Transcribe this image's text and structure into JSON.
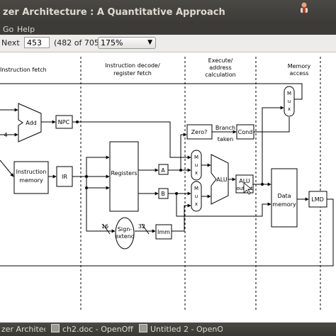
{
  "window": {
    "title": "zer Architecture : A Quantitative Approach"
  },
  "menu": {
    "go": "Go",
    "help": "Help"
  },
  "toolbar": {
    "next_label": "Next",
    "page_value": "453",
    "page_count": "(482 of 705)",
    "zoom_value": "175%"
  },
  "diagram": {
    "stages": {
      "fetch": "Instruction fetch",
      "decode_1": "Instruction decode/",
      "decode_2": "register fetch",
      "exec_1": "Execute/",
      "exec_2": "address",
      "exec_3": "calculation",
      "mem_1": "Memory",
      "mem_2": "access"
    },
    "blocks": {
      "add": "Add",
      "four": "4",
      "npc": "NPC",
      "imem_1": "Instruction",
      "imem_2": "memory",
      "ir": "IR",
      "registers": "Registers",
      "a": "A",
      "b": "B",
      "zero": "Zero?",
      "branch_1": "Branch",
      "branch_2": "taken",
      "cond": "Cond",
      "mux": "M u x",
      "alu": "ALU",
      "alu_out_1": "ALU",
      "alu_out_2": "output",
      "dmem_1": "Data",
      "dmem_2": "memory",
      "lmd": "LMD",
      "sign_1": "Sign-",
      "sign_2": "extend",
      "imm": "Imm",
      "w16": "16",
      "w32": "32"
    }
  },
  "taskbar": {
    "item1": "zer Architectur...",
    "item2": "ch2.doc - OpenOffice....",
    "item3": "Untitled 2 - OpenOffic..."
  }
}
